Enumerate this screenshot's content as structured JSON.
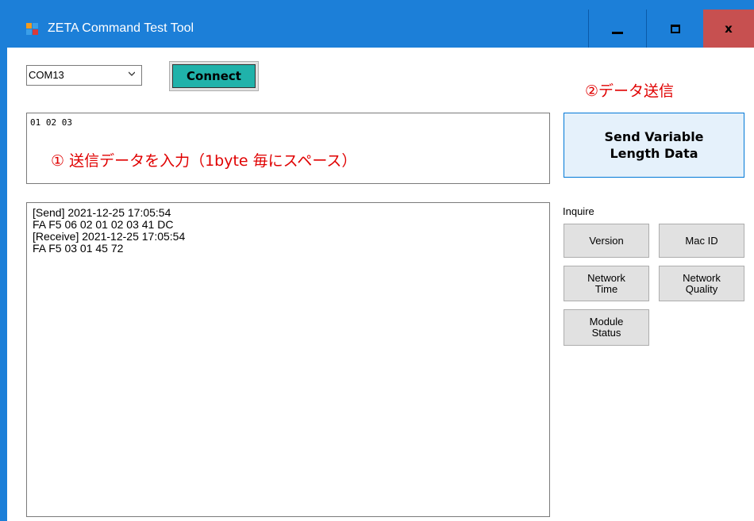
{
  "window": {
    "title": "ZETA Command Test Tool",
    "controls": {
      "minimize_icon": "minimize-icon",
      "maximize_icon": "maximize-icon",
      "close_label": "x"
    },
    "colors": {
      "titlebar": "#1c7fd8",
      "close": "#c75050"
    }
  },
  "port_select": {
    "value": "COM13"
  },
  "connect": {
    "label": "Connect",
    "color": "#20b2aa"
  },
  "data_input": {
    "value": "01 02 03"
  },
  "annotations": {
    "input": "① 送信データを入力（1byte 毎にスペース）",
    "send": "②データ送信",
    "color": "#e00000"
  },
  "send_button": {
    "line1": "Send Variable",
    "line2": "Length Data"
  },
  "log": {
    "lines": [
      "[Send] 2021-12-25 17:05:54",
      "FA F5 06 02 01 02 03 41 DC",
      "[Receive] 2021-12-25 17:05:54",
      "FA F5 03 01 45 72"
    ]
  },
  "inquire": {
    "label": "Inquire",
    "version": "Version",
    "mac_id": "Mac ID",
    "network_time": {
      "line1": "Network",
      "line2": "Time"
    },
    "network_quality": {
      "line1": "Network",
      "line2": "Quality"
    },
    "module_status": {
      "line1": "Module",
      "line2": "Status"
    }
  }
}
